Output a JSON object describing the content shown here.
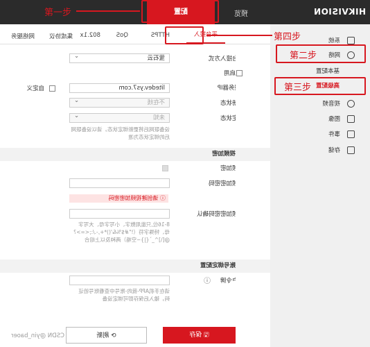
{
  "header": {
    "logo": "HIKVISION",
    "nav": [
      "预览",
      "配置"
    ]
  },
  "sidebar": {
    "items": [
      {
        "label": "系统",
        "icon": "monitor-icon"
      },
      {
        "label": "网络",
        "icon": "globe-icon"
      },
      {
        "label": "基本配置"
      },
      {
        "label": "高级配置",
        "selected": true
      },
      {
        "label": "视音频",
        "icon": "audio-video-icon"
      },
      {
        "label": "图像",
        "icon": "image-icon"
      },
      {
        "label": "事件",
        "icon": "calendar-icon"
      },
      {
        "label": "存储",
        "icon": "storage-icon"
      }
    ]
  },
  "tabs": [
    "平台接入",
    "HTTPS",
    "QoS",
    "802.1x",
    "集成协议",
    "网络服务"
  ],
  "form": {
    "access_mode": {
      "label": "平台接入方式",
      "value": "萤石云"
    },
    "enable": {
      "label": "启用",
      "checked": false
    },
    "server_ip": {
      "label": "接入服务器IP",
      "value": "litedev.ys7.com",
      "custom_label": "自定义"
    },
    "reg_status": {
      "label": "注册状态",
      "value": "不在线"
    },
    "bind_status": {
      "label": "绑定状态",
      "value": "未知"
    },
    "bind_hint": "设备联网后将更新绑定状态，请以设备联网后的绑定状态为准",
    "video_section": "视频加密",
    "video_enc": {
      "label": "视频加密"
    },
    "enc_pwd": {
      "label": "视频加密密码",
      "value": ""
    },
    "enc_error": "请创建视频加密密码",
    "enc_confirm": {
      "label": "视频加密密码确认",
      "value": ""
    },
    "pwd_hint": "8-16位,只能用数字、小写字母、大写字母、特殊字符（!\"#$%&'()*+,-./:;<=>?@[\\]^_`{|}~空格）两种及以上组合",
    "account_section": "账号绑定配置",
    "token": {
      "label": "用户令牌",
      "value": ""
    },
    "token_hint": "请在手机APP-我的-账号中查看账号验证码，输入后保存即可绑定设备"
  },
  "buttons": {
    "save": "保存",
    "refresh": "刷新"
  },
  "watermark": "CSDN @yin_baoer",
  "annotations": [
    "第一步",
    "第二步",
    "第三步",
    "第四步"
  ],
  "colors": {
    "accent": "#d7171f",
    "topbar": "#2b2b2b"
  }
}
